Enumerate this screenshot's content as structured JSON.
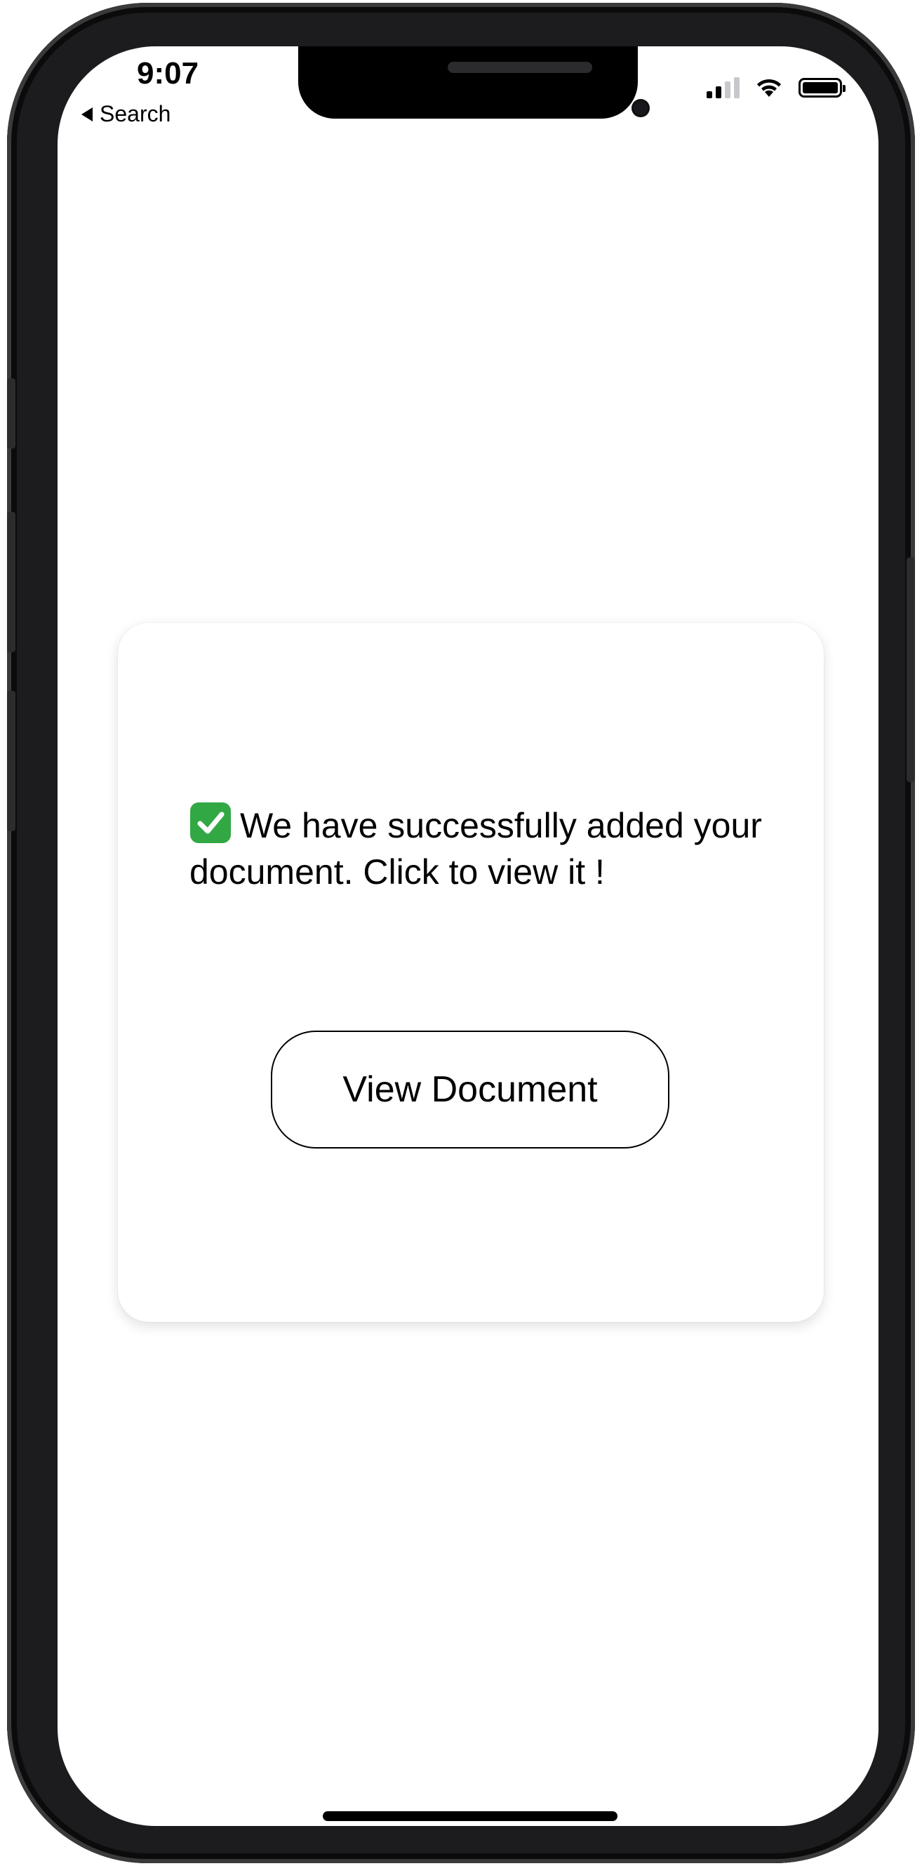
{
  "status_bar": {
    "time": "9:07",
    "back_label": "Search",
    "icons": [
      "signal-icon",
      "wifi-icon",
      "battery-icon"
    ]
  },
  "card": {
    "check_icon": "check-mark-button-icon",
    "message": "We have successfully added your document. Click to view it !",
    "button_label": "View Document"
  },
  "colors": {
    "check_green": "#32a845",
    "button_border": "#000000",
    "text": "#000000",
    "background": "#ffffff"
  }
}
